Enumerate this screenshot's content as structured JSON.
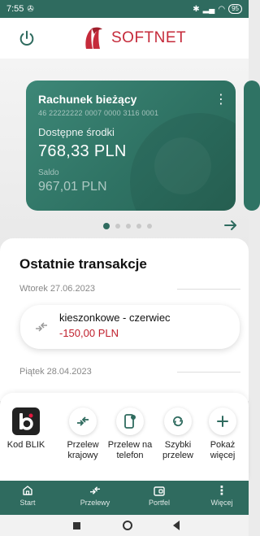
{
  "status": {
    "time": "7:55",
    "battery": "95"
  },
  "header": {
    "brand": "SOFTNET"
  },
  "account": {
    "title": "Rachunek bieżący",
    "number": "46 22222222 0007 0000 3116 0001",
    "available_label": "Dostępne środki",
    "available_value": "768,33 PLN",
    "saldo_label": "Saldo",
    "saldo_value": "967,01 PLN"
  },
  "carousel": {
    "pages": 5,
    "active": 1
  },
  "transactions": {
    "title": "Ostatnie transakcje",
    "groups": [
      {
        "date": "Wtorek 27.06.2023",
        "items": [
          {
            "title": "kieszonkowe - czerwiec",
            "amount": "-150,00 PLN"
          }
        ]
      },
      {
        "date": "Piątek 28.04.2023",
        "items": []
      }
    ]
  },
  "actions": [
    {
      "label": "Kod BLIK",
      "icon": "blik-icon"
    },
    {
      "label": "Przelew krajowy",
      "icon": "transfer-icon"
    },
    {
      "label": "Przelew na telefon",
      "icon": "phone-transfer-icon"
    },
    {
      "label": "Szybki przelew",
      "icon": "quick-transfer-icon"
    },
    {
      "label": "Pokaż więcej",
      "icon": "plus-icon"
    }
  ],
  "tabs": [
    {
      "label": "Start",
      "icon": "home-icon"
    },
    {
      "label": "Przelewy",
      "icon": "transfer-icon"
    },
    {
      "label": "Portfel",
      "icon": "wallet-icon"
    },
    {
      "label": "Więcej",
      "icon": "more-icon"
    }
  ],
  "colors": {
    "primary": "#2f6b5f",
    "brand_red": "#c52a3a",
    "negative": "#c0202d"
  }
}
